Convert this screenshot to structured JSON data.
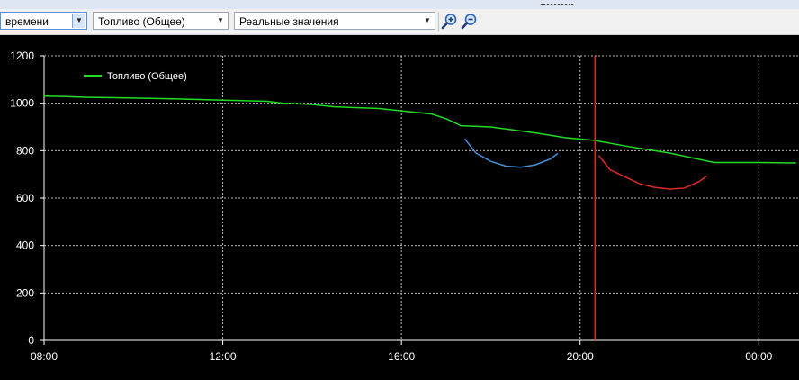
{
  "toolbar": {
    "time_select": "времени",
    "series_select": "Топливо (Общее)",
    "mode_select": "Реальные значения",
    "zoom_in_icon": "zoom-in-icon",
    "zoom_out_icon": "zoom-out-icon"
  },
  "colors": {
    "background": "#000000",
    "grid": "#bdbdbd",
    "fuel_line": "#22dd22",
    "blue_arc": "#4a8fd8",
    "red_arc": "#e02828",
    "cursor": "#e02828",
    "text": "#ffffff"
  },
  "chart_data": {
    "type": "line",
    "title": "",
    "xlabel": "",
    "ylabel": "",
    "x_ticks": [
      "08:00",
      "12:00",
      "16:00",
      "20:00",
      "00:00"
    ],
    "y_ticks": [
      0,
      200,
      400,
      600,
      800,
      1000,
      1200
    ],
    "ylim": [
      0,
      1200
    ],
    "xlim_hours": [
      8,
      24.9
    ],
    "grid": true,
    "legend_position": "top-left",
    "cursor_time": "20:20",
    "series": [
      {
        "name": "Топливо (Общее)",
        "color": "#22dd22",
        "points": [
          [
            "08:00",
            1030
          ],
          [
            "08:30",
            1028
          ],
          [
            "09:00",
            1025
          ],
          [
            "10:00",
            1022
          ],
          [
            "11:00",
            1018
          ],
          [
            "12:00",
            1013
          ],
          [
            "13:00",
            1008
          ],
          [
            "13:20",
            1000
          ],
          [
            "14:00",
            995
          ],
          [
            "14:30",
            985
          ],
          [
            "15:30",
            978
          ],
          [
            "16:00",
            968
          ],
          [
            "16:40",
            955
          ],
          [
            "17:00",
            935
          ],
          [
            "17:20",
            905
          ],
          [
            "18:00",
            900
          ],
          [
            "19:00",
            875
          ],
          [
            "19:40",
            855
          ],
          [
            "20:20",
            843
          ],
          [
            "21:00",
            820
          ],
          [
            "22:00",
            790
          ],
          [
            "22:30",
            770
          ],
          [
            "23:00",
            750
          ],
          [
            "24:00",
            750
          ],
          [
            "24:50",
            748
          ]
        ]
      },
      {
        "color": "#4a8fd8",
        "points": [
          [
            "17:25",
            850
          ],
          [
            "17:40",
            790
          ],
          [
            "18:00",
            755
          ],
          [
            "18:20",
            735
          ],
          [
            "18:40",
            730
          ],
          [
            "19:00",
            740
          ],
          [
            "19:20",
            765
          ],
          [
            "19:30",
            788
          ]
        ]
      },
      {
        "color": "#e02828",
        "points": [
          [
            "20:25",
            780
          ],
          [
            "20:40",
            720
          ],
          [
            "21:00",
            690
          ],
          [
            "21:20",
            660
          ],
          [
            "21:40",
            645
          ],
          [
            "22:00",
            638
          ],
          [
            "22:20",
            642
          ],
          [
            "22:40",
            670
          ],
          [
            "22:50",
            693
          ]
        ]
      }
    ]
  }
}
